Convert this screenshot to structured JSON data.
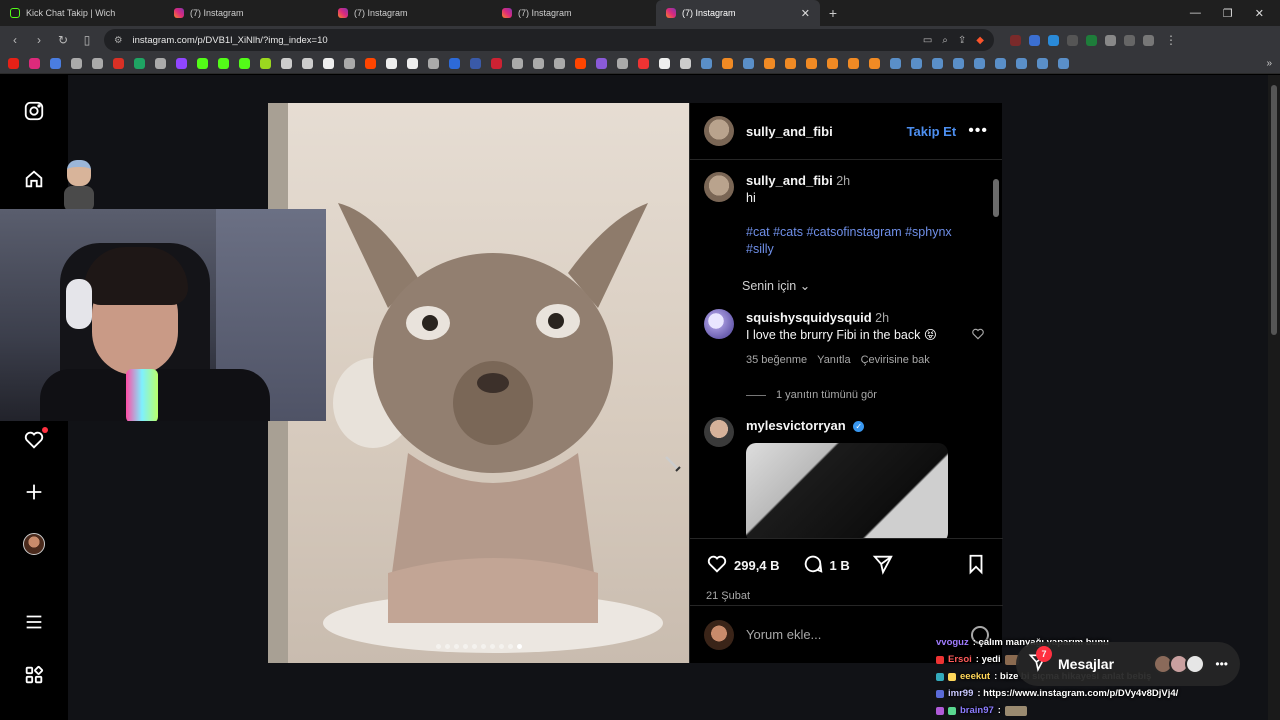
{
  "browser": {
    "tabs": [
      {
        "label": "Kick Chat Takip | Wich",
        "icon": "kick-icon",
        "active": false
      },
      {
        "label": "(7) Instagram",
        "icon": "instagram-icon",
        "active": false
      },
      {
        "label": "(7) Instagram",
        "icon": "instagram-icon",
        "active": false
      },
      {
        "label": "(7) Instagram",
        "icon": "instagram-icon",
        "active": false
      },
      {
        "label": "(7) Instagram",
        "icon": "instagram-icon",
        "active": true
      }
    ],
    "url": "instagram.com/p/DVB1l_XiNlh/?img_index=10"
  },
  "post": {
    "author": "sully_and_fibi",
    "follow_label": "Takip Et",
    "caption_author": "sully_and_fibi",
    "caption_time": "2h",
    "caption_text": "hi",
    "caption_tags_line1": "#cat #cats #catsofinstagram #sphynx",
    "caption_tags_line2": "#silly",
    "sort_label": "Senin için",
    "carousel_count": 10,
    "carousel_index": 10,
    "comments": [
      {
        "author": "squishysquidysquid",
        "time": "2h",
        "text": "I love the brurry Fibi in the back 😝",
        "likes": "35 beğenme",
        "reply": "Yanıtla",
        "translate": "Çevirisine bak",
        "view_replies": "1 yanıtın tümünü gör"
      },
      {
        "author": "mylesvictorryan",
        "verified": true
      }
    ],
    "like_count": "299,4 B",
    "comment_count": "1 B",
    "date": "21 Şubat",
    "comment_placeholder": "Yorum ekle..."
  },
  "chat": [
    {
      "user": "vvoguz",
      "text": ": çalım manyağı yaparım bunu"
    },
    {
      "user": "Ersoi",
      "text": ": yedi"
    },
    {
      "user": "eeekut",
      "text": ": bize bi sıçma hikayesi anlat bebiş"
    },
    {
      "user": "imr99",
      "text": ": https://www.instagram.com/p/DVy4v8DjVj4/"
    },
    {
      "user": "brain97",
      "text": ":"
    }
  ],
  "messages": {
    "label": "Mesajlar",
    "count": "7"
  }
}
